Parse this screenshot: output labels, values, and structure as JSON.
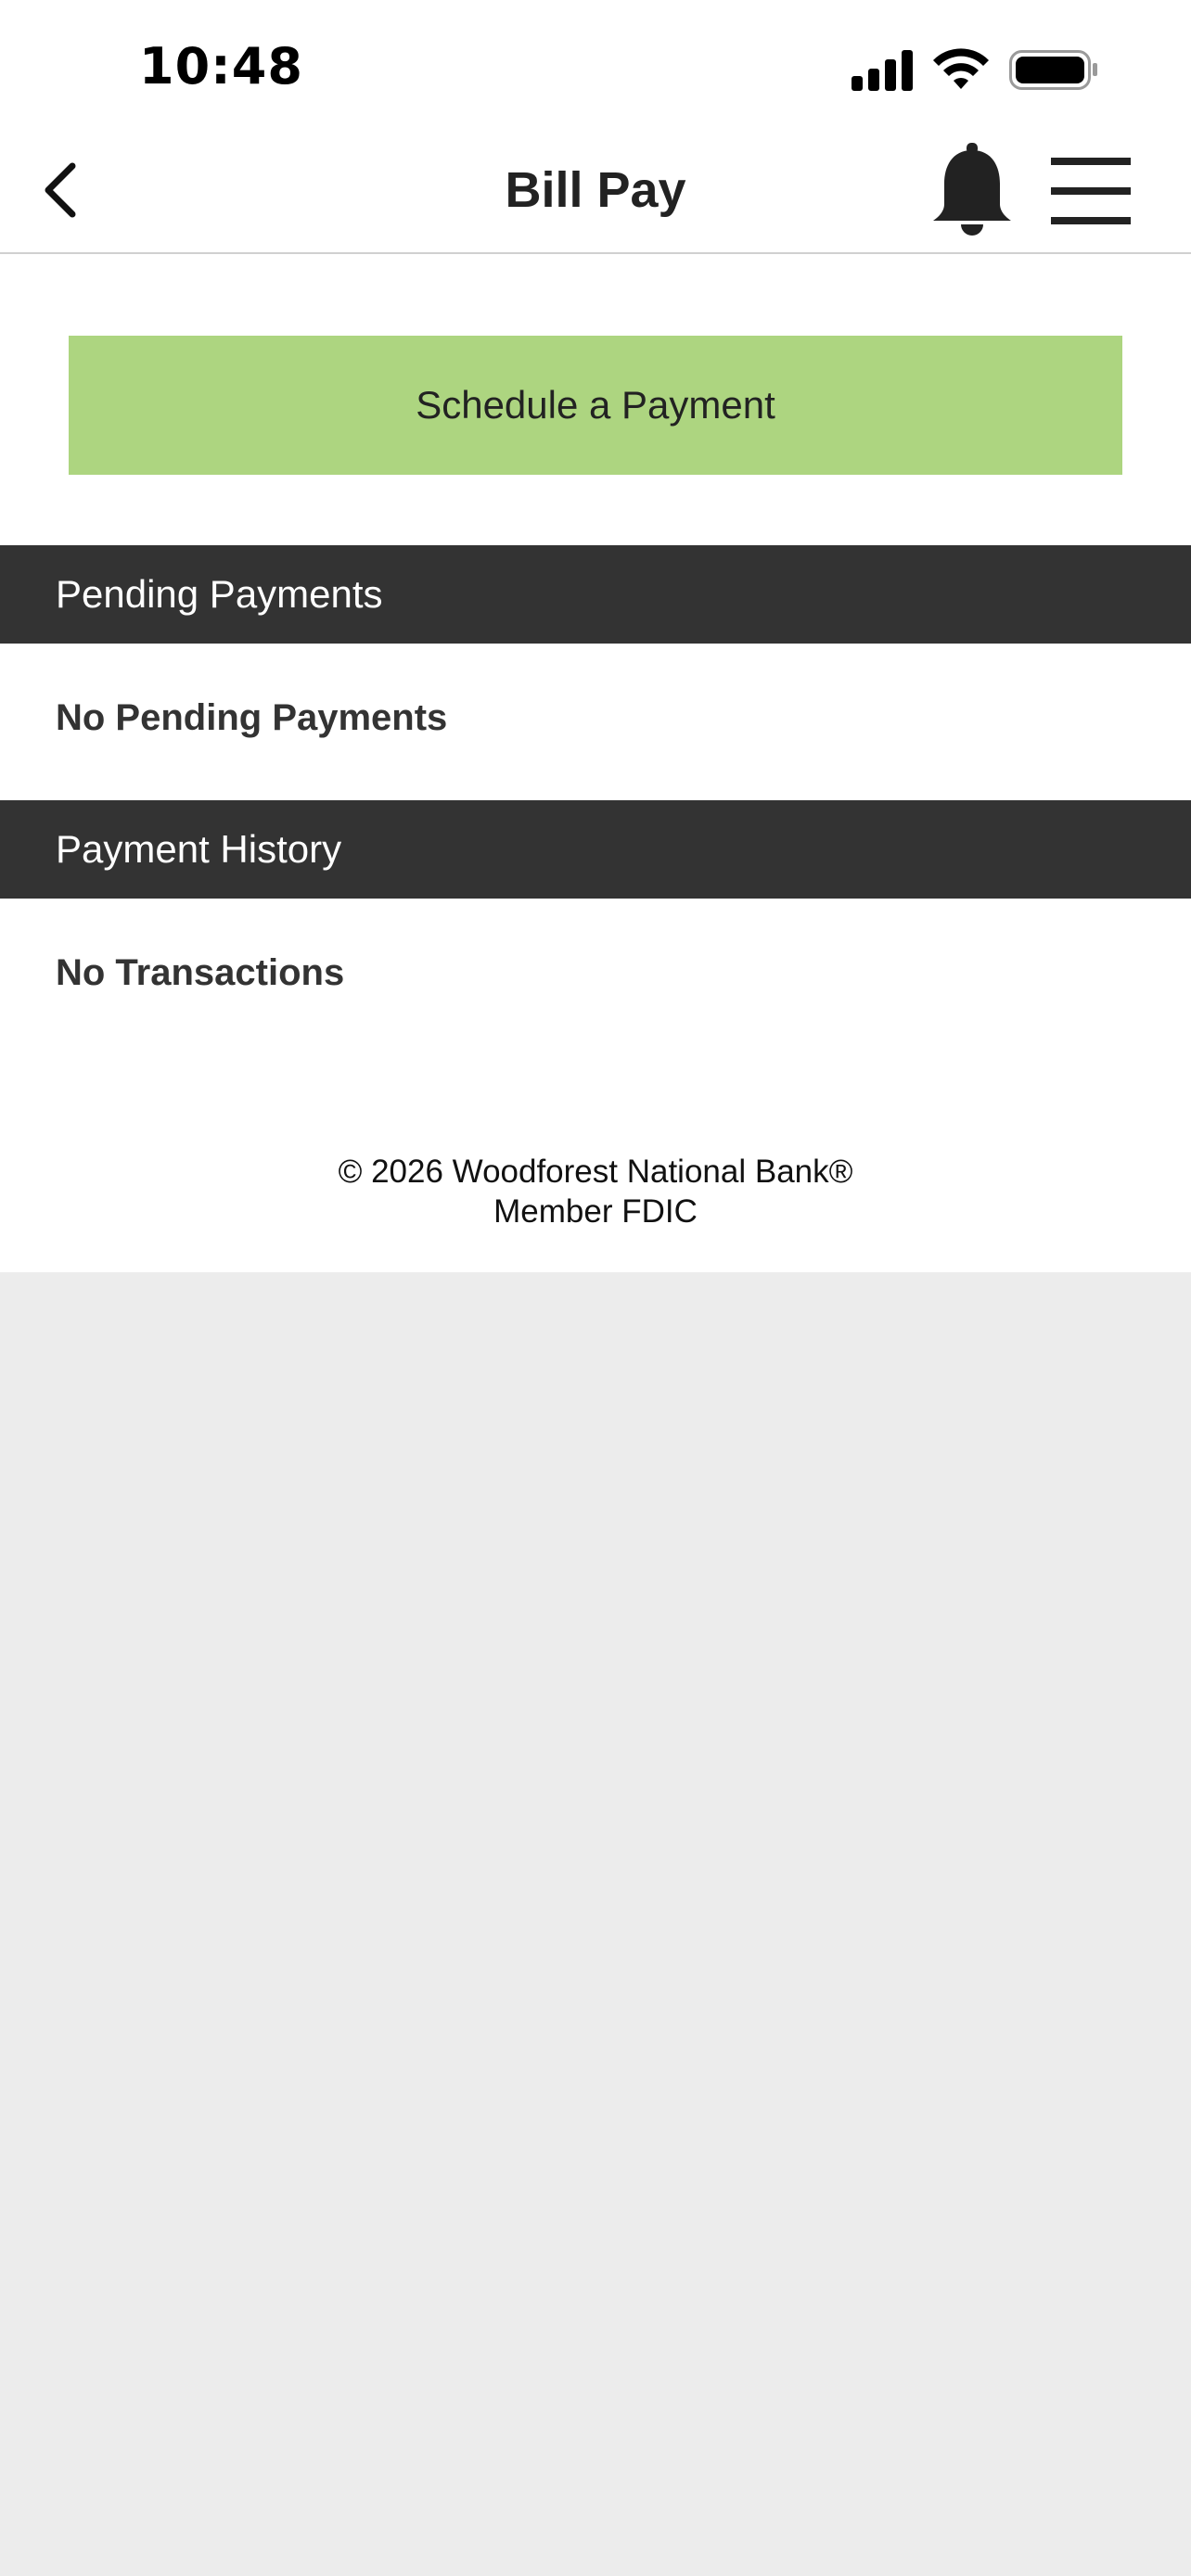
{
  "status_bar": {
    "time": "10:48",
    "icons": [
      "signal-icon",
      "wifi-icon",
      "battery-icon"
    ]
  },
  "header": {
    "title": "Bill Pay",
    "back_icon": "chevron-left-icon",
    "notifications_icon": "bell-icon",
    "menu_icon": "hamburger-menu-icon"
  },
  "actions": {
    "schedule_label": "Schedule a Payment"
  },
  "pending": {
    "header": "Pending Payments",
    "empty_text": "No Pending Payments"
  },
  "history": {
    "header": "Payment History",
    "empty_text": "No Transactions"
  },
  "footer": {
    "copyright": "© 2026 Woodforest National Bank®",
    "member": "Member FDIC"
  },
  "colors": {
    "accent_button": "#add580",
    "section_header_bg": "#333333",
    "page_bg": "#ececec"
  }
}
